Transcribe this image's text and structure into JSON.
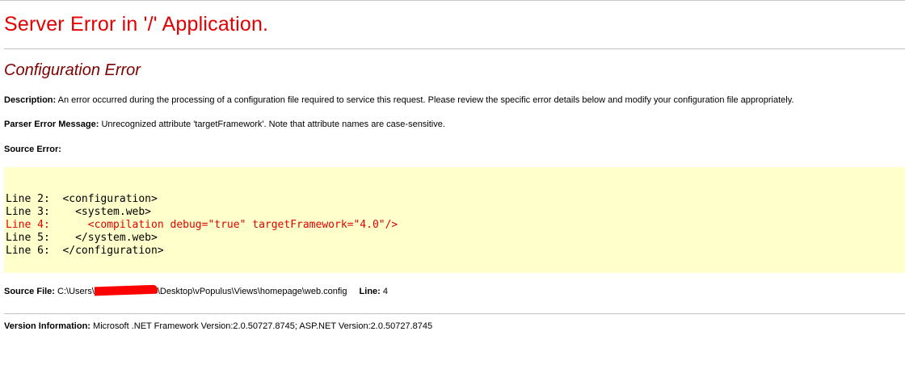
{
  "error_page": {
    "title": "Server Error in '/' Application.",
    "subtitle": "Configuration Error",
    "description_label": "Description:",
    "description_text": "An error occurred during the processing of a configuration file required to service this request. Please review the specific error details below and modify your configuration file appropriately.",
    "parser_label": "Parser Error Message:",
    "parser_text": "Unrecognized attribute 'targetFramework'. Note that attribute names are case-sensitive.",
    "source_error_label": "Source Error:",
    "source_lines": [
      {
        "text": "Line 2:  <configuration>",
        "highlight": false
      },
      {
        "text": "Line 3:    <system.web>",
        "highlight": false
      },
      {
        "text": "Line 4:      <compilation debug=\"true\" targetFramework=\"4.0\"/>",
        "highlight": true
      },
      {
        "text": "Line 5:    </system.web>",
        "highlight": false
      },
      {
        "text": "Line 6:  </configuration>",
        "highlight": false
      }
    ],
    "source_file_label": "Source File:",
    "source_file_path_before": "C:\\Users\\",
    "source_file_path_after": "\\Desktop\\vPopulus\\Views\\homepage\\web.config",
    "line_label": "Line:",
    "line_number": "4",
    "version_label": "Version Information:",
    "version_text": "Microsoft .NET Framework Version:2.0.50727.8745; ASP.NET Version:2.0.50727.8745",
    "colors": {
      "title_red": "#e20000",
      "subtitle_maroon": "#800000",
      "code_background": "#ffffcc",
      "redaction_red": "#ff0000"
    }
  }
}
